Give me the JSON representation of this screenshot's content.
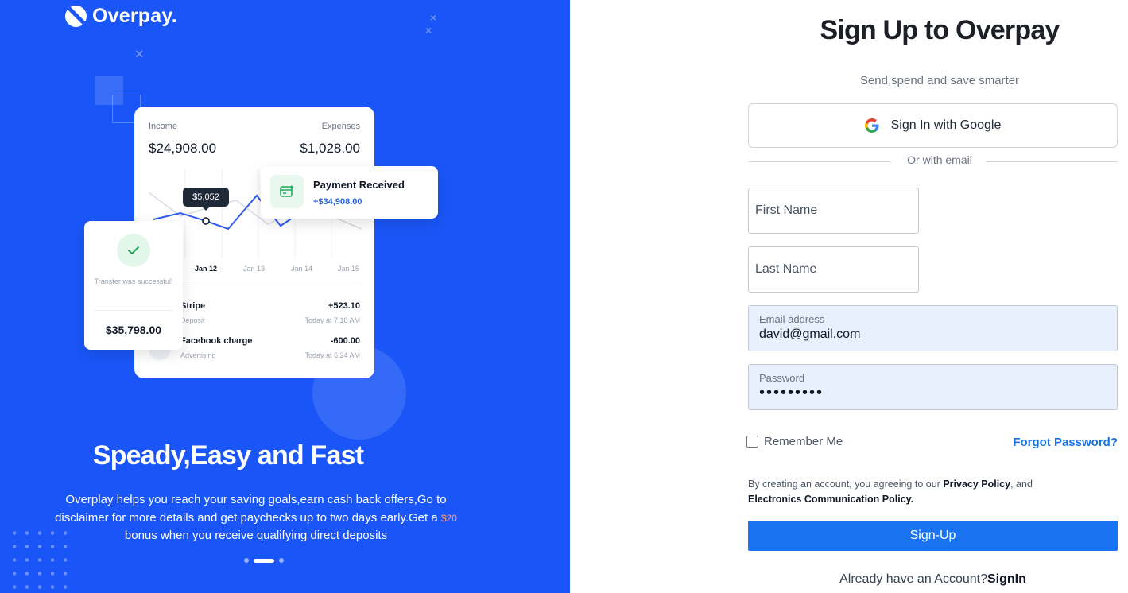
{
  "brand": {
    "name": "Overpay."
  },
  "promo": {
    "income_label": "Income",
    "income_value": "$24,908.00",
    "expenses_label": "Expenses",
    "expenses_value": "$1,028.00",
    "tooltip_value": "$5,052",
    "chart_dates": [
      "Jan 12",
      "Jan 13",
      "Jan 14",
      "Jan 15"
    ],
    "payment_title": "Payment Received",
    "payment_amount": "+$34,908.00",
    "success_text": "Transfer was successful!",
    "success_amount": "$35,798.00",
    "transactions": [
      {
        "name": "Stripe",
        "type": "Deposit",
        "amount": "+523.10",
        "time": "Today at 7.18 AM"
      },
      {
        "name": "Facebook charge",
        "type": "Advertising",
        "amount": "-600.00",
        "time": "Today at 6.24 AM"
      }
    ],
    "headline": "Speady,Easy and Fast",
    "description_part1": "Overplay helps you reach your saving goals,earn cash back offers,Go to disclaimer for more details and get paychecks up to two days early.Get a",
    "description_highlight": "$20",
    "description_part2": "bonus when you receive qualifying direct deposits",
    "carousel_active_index": 1,
    "carousel_count": 3
  },
  "form": {
    "title": "Sign Up to Overpay",
    "subtitle": "Send,spend and save smarter",
    "google_label": "Sign In with Google",
    "divider_text": "Or with email",
    "first_name_placeholder": "First Name",
    "last_name_placeholder": "Last Name",
    "email_label": "Email address",
    "email_value": "david@gmail.com",
    "password_label": "Password",
    "password_mask": "•••••••••",
    "remember_label": "Remember Me",
    "forgot_label": "Forgot Password?",
    "terms_prefix": "By creating an account, you agreeing to our",
    "privacy_link": "Privacy Policy",
    "terms_and": ", and",
    "ecp_link": "Electronics Communication Policy.",
    "signup_label": "Sign-Up",
    "already_text": "Already have an Account?",
    "signin_link": "SignIn"
  },
  "colors": {
    "brand_blue": "#1a55f7",
    "button_blue": "#1a73f0",
    "link_blue": "#1a73e8",
    "autofill_bg": "#e8f0fe"
  },
  "icons": [
    "logo-icon",
    "check-icon",
    "payment-icon",
    "google-icon"
  ]
}
